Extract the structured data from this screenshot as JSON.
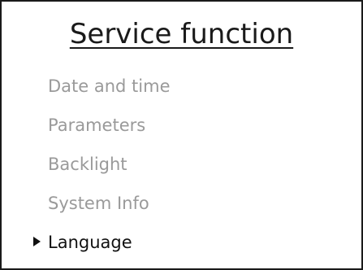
{
  "screen": {
    "title": "Service function"
  },
  "menu": {
    "items": [
      {
        "label": "Date and time",
        "selected": false
      },
      {
        "label": "Parameters",
        "selected": false
      },
      {
        "label": "Backlight",
        "selected": false
      },
      {
        "label": "System Info",
        "selected": false
      },
      {
        "label": "Language",
        "selected": true
      }
    ],
    "cursor_icon": "triangle-right-icon"
  },
  "colors": {
    "title": "#1a1a1a",
    "item_inactive": "#9a9a9a",
    "item_selected": "#111111",
    "border": "#1a1a1a"
  }
}
